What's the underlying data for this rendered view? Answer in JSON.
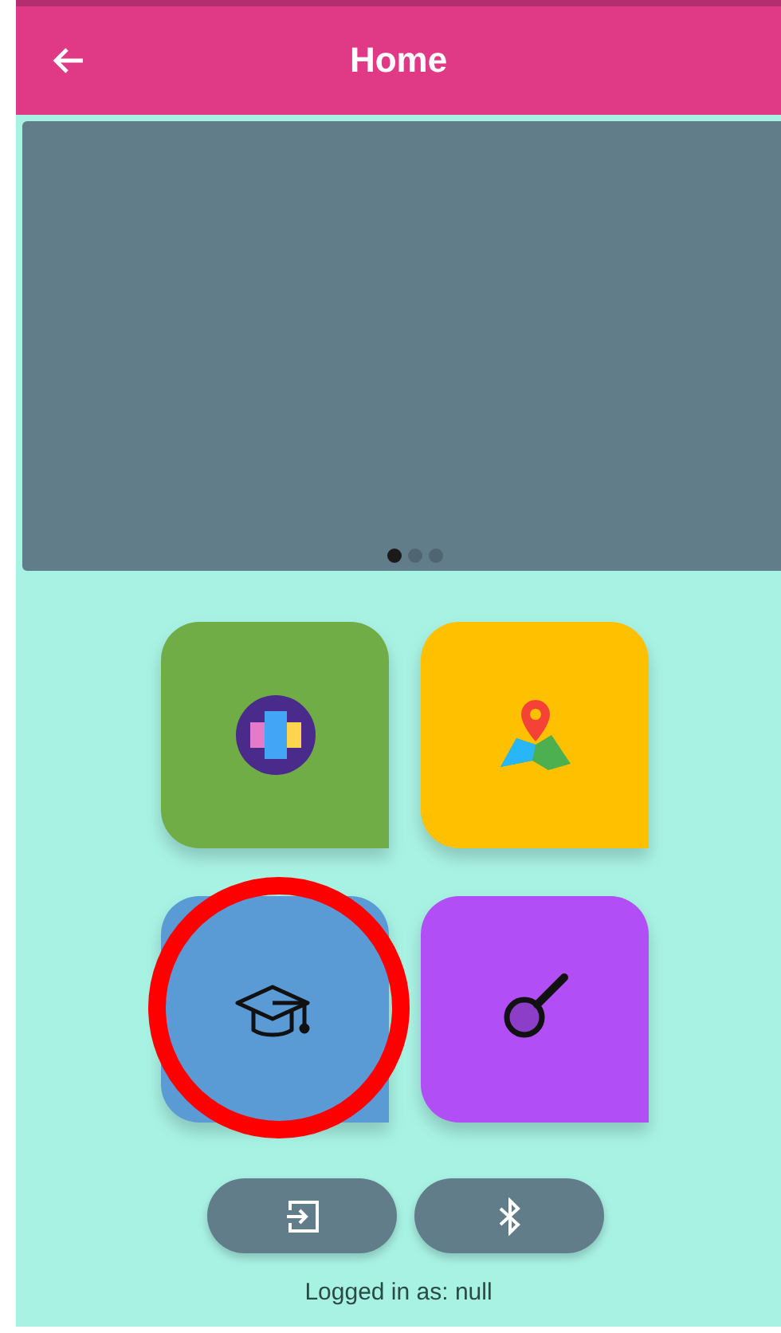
{
  "app_bar": {
    "title": "Home"
  },
  "carousel": {
    "dots": [
      {
        "selected": true
      },
      {
        "selected": false
      },
      {
        "selected": false
      }
    ]
  },
  "tiles": [
    {
      "kind": "directory",
      "color": "#70ad47",
      "highlighted": false
    },
    {
      "kind": "map",
      "color": "#ffc000",
      "highlighted": false
    },
    {
      "kind": "education",
      "color": "#5b9bd5",
      "highlighted": true
    },
    {
      "kind": "search",
      "color": "#b14ef5",
      "highlighted": false
    }
  ],
  "actions": [
    {
      "kind": "login"
    },
    {
      "kind": "bluetooth"
    }
  ],
  "status": "Logged in as: null"
}
